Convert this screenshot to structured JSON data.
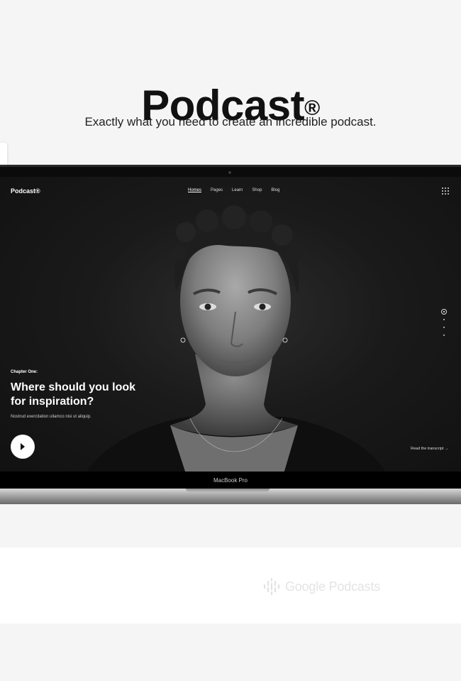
{
  "page": {
    "title": "Podcast",
    "title_mark": "®",
    "subtitle": "Exactly what you need to create an incredible podcast."
  },
  "site": {
    "logo": "Podcast®",
    "nav": [
      "Homes",
      "Pages",
      "Learn",
      "Shop",
      "Blog"
    ],
    "active_nav": "Homes",
    "chapter": "Chapter One:",
    "headline": "Where should you look for inspiration?",
    "lead": "Nostrud exercitation ullamco nisi ut aliquip.",
    "transcript_link": "Read the transcript",
    "transcript_arrow": "→",
    "slide_dots": 4,
    "active_slide": 1
  },
  "device_label": "MacBook Pro",
  "partner_logo": {
    "name": "Google Podcasts"
  },
  "colors": {
    "page_bg": "#f5f5f5",
    "screen_bg": "#1a1a1a",
    "accent": "#ffffff"
  }
}
